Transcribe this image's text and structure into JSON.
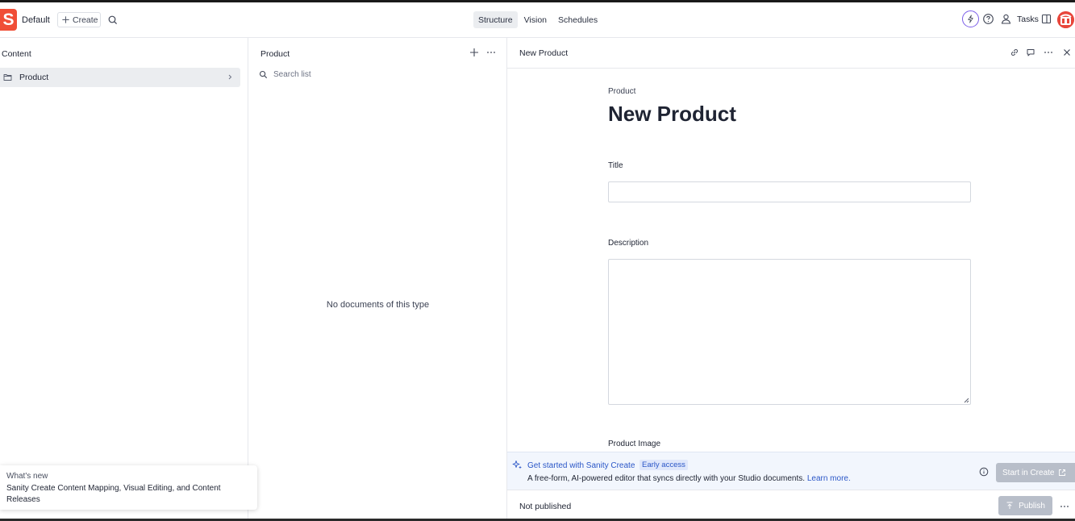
{
  "topbar": {
    "logo_letter": "S",
    "workspace_name": "Default",
    "create_label": "Create",
    "tabs": [
      {
        "label": "Structure",
        "active": true
      },
      {
        "label": "Vision",
        "active": false
      },
      {
        "label": "Schedules",
        "active": false
      }
    ],
    "tasks_label": "Tasks",
    "accent_color": "#7b5ee8",
    "brand_color": "#f04e37"
  },
  "content_pane": {
    "title": "Content",
    "items": [
      {
        "label": "Product",
        "icon": "folder-icon",
        "selected": true
      }
    ]
  },
  "list_pane": {
    "title": "Product",
    "search_placeholder": "Search list",
    "empty_message": "No documents of this type"
  },
  "document": {
    "header_title": "New Product",
    "type_label": "Product",
    "title": "New Product",
    "fields": [
      {
        "label": "Title",
        "value": ""
      },
      {
        "label": "Description",
        "value": ""
      },
      {
        "label": "Product Image"
      }
    ]
  },
  "create_banner": {
    "title": "Get started with Sanity Create",
    "badge": "Early access",
    "description": "A free-form, AI-powered editor that syncs directly with your Studio documents.",
    "link": "Learn more.",
    "button_label": "Start in Create"
  },
  "footer": {
    "status": "Not published",
    "publish_label": "Publish"
  },
  "whats_new": {
    "heading": "What's new",
    "body": "Sanity Create Content Mapping, Visual Editing, and Content Releases"
  }
}
